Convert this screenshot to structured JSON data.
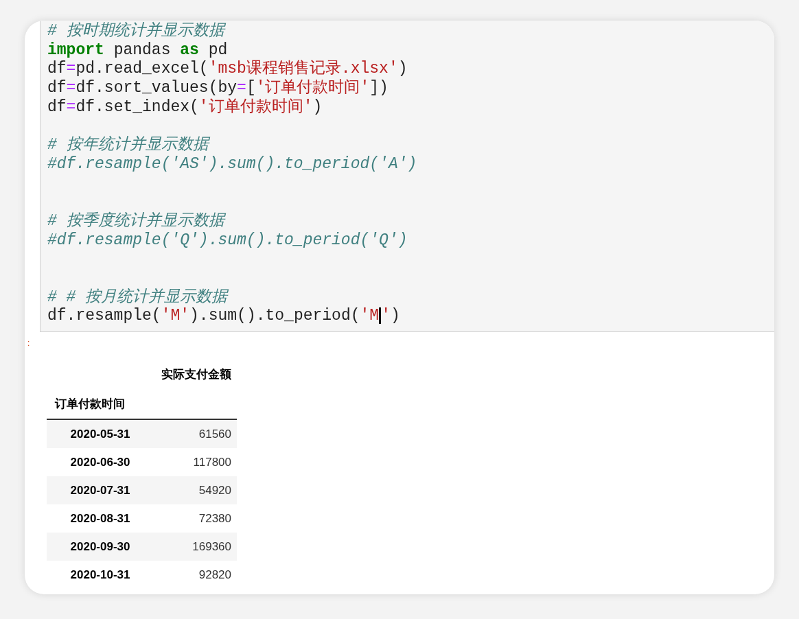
{
  "code_cell": {
    "lines": [
      {
        "kind": "code",
        "tokens": [
          {
            "kind": "comment",
            "text": "# 按时期统计并显示数据"
          }
        ]
      },
      {
        "kind": "code",
        "tokens": [
          {
            "kind": "keyword",
            "text": "import"
          },
          {
            "kind": "plain",
            "text": " pandas "
          },
          {
            "kind": "keyword",
            "text": "as"
          },
          {
            "kind": "plain",
            "text": " pd"
          }
        ]
      },
      {
        "kind": "code",
        "tokens": [
          {
            "kind": "plain",
            "text": "df"
          },
          {
            "kind": "operator",
            "text": "="
          },
          {
            "kind": "plain",
            "text": "pd.read_excel("
          },
          {
            "kind": "string",
            "text": "'msb课程销售记录.xlsx'"
          },
          {
            "kind": "plain",
            "text": ")"
          }
        ]
      },
      {
        "kind": "code",
        "tokens": [
          {
            "kind": "plain",
            "text": "df"
          },
          {
            "kind": "operator",
            "text": "="
          },
          {
            "kind": "plain",
            "text": "df.sort_values(by"
          },
          {
            "kind": "operator",
            "text": "="
          },
          {
            "kind": "plain",
            "text": "["
          },
          {
            "kind": "string",
            "text": "'订单付款时间'"
          },
          {
            "kind": "plain",
            "text": "])"
          }
        ]
      },
      {
        "kind": "code",
        "tokens": [
          {
            "kind": "plain",
            "text": "df"
          },
          {
            "kind": "operator",
            "text": "="
          },
          {
            "kind": "plain",
            "text": "df.set_index("
          },
          {
            "kind": "string",
            "text": "'订单付款时间'"
          },
          {
            "kind": "plain",
            "text": ")"
          }
        ]
      },
      {
        "kind": "blank"
      },
      {
        "kind": "code",
        "tokens": [
          {
            "kind": "comment",
            "text": "# 按年统计并显示数据"
          }
        ]
      },
      {
        "kind": "code",
        "tokens": [
          {
            "kind": "comment",
            "text": "#df.resample('AS').sum().to_period('A')"
          }
        ]
      },
      {
        "kind": "blank"
      },
      {
        "kind": "blank"
      },
      {
        "kind": "code",
        "tokens": [
          {
            "kind": "comment",
            "text": "# 按季度统计并显示数据"
          }
        ]
      },
      {
        "kind": "code",
        "tokens": [
          {
            "kind": "comment",
            "text": "#df.resample('Q').sum().to_period('Q')"
          }
        ]
      },
      {
        "kind": "blank"
      },
      {
        "kind": "blank"
      },
      {
        "kind": "code",
        "tokens": [
          {
            "kind": "comment",
            "text": "# # 按月统计并显示数据"
          }
        ]
      },
      {
        "kind": "code",
        "tokens": [
          {
            "kind": "plain",
            "text": "df.resample("
          },
          {
            "kind": "string",
            "text": "'M'"
          },
          {
            "kind": "plain",
            "text": ").sum().to_period("
          },
          {
            "kind": "string",
            "text": "'M"
          },
          {
            "kind": "cursor"
          },
          {
            "kind": "string",
            "text": "'"
          },
          {
            "kind": "plain",
            "text": ")"
          }
        ]
      }
    ]
  },
  "output_prompt": ":",
  "table": {
    "column_header": "实际支付金额",
    "index_name": "订单付款时间",
    "rows": [
      {
        "index": "2020-05-31",
        "value": "61560"
      },
      {
        "index": "2020-06-30",
        "value": "117800"
      },
      {
        "index": "2020-07-31",
        "value": "54920"
      },
      {
        "index": "2020-08-31",
        "value": "72380"
      },
      {
        "index": "2020-09-30",
        "value": "169360"
      },
      {
        "index": "2020-10-31",
        "value": "92820"
      }
    ]
  }
}
